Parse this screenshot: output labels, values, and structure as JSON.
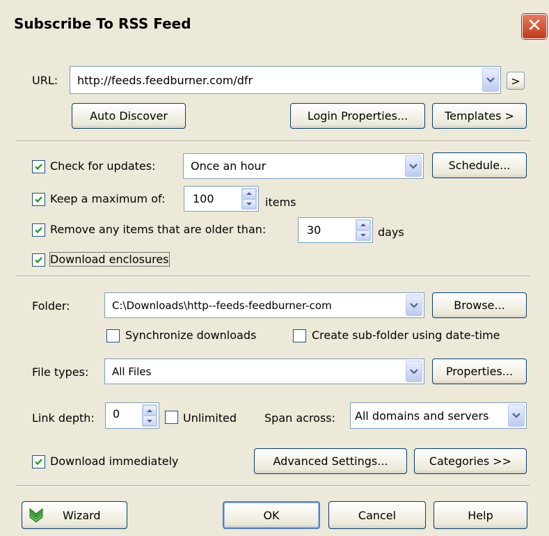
{
  "window": {
    "title": "Subscribe To RSS Feed",
    "close": "✕"
  },
  "url": {
    "label": "URL:",
    "value": "http://feeds.feedburner.com/dfr",
    "go": ">"
  },
  "buttons": {
    "auto_discover": "Auto Discover",
    "login_properties": "Login Properties...",
    "templates": "Templates >",
    "schedule": "Schedule...",
    "browse": "Browse...",
    "properties": "Properties...",
    "advanced_settings": "Advanced Settings...",
    "categories": "Categories >>",
    "wizard": "Wizard",
    "ok": "OK",
    "cancel": "Cancel",
    "help": "Help"
  },
  "updates": {
    "check_label": "Check for updates:",
    "check_checked": true,
    "frequency": "Once an hour",
    "max_label": "Keep a maximum of:",
    "max_checked": true,
    "max_value": "100",
    "max_unit": "items",
    "remove_label": "Remove any items that are older than:",
    "remove_checked": true,
    "remove_value": "30",
    "remove_unit": "days",
    "enclosures_label": "Download enclosures",
    "enclosures_checked": true
  },
  "download": {
    "folder_label": "Folder:",
    "folder_value": "C:\\Downloads\\http--feeds-feedburner-com",
    "sync_label": "Synchronize downloads",
    "sync_checked": false,
    "subfolder_label": "Create sub-folder using date-time",
    "subfolder_checked": false,
    "filetypes_label": "File types:",
    "filetypes_value": "All Files",
    "linkdepth_label": "Link depth:",
    "linkdepth_value": "0",
    "unlimited_label": "Unlimited",
    "unlimited_checked": false,
    "span_label": "Span across:",
    "span_value": "All domains and servers",
    "immediately_label": "Download immediately",
    "immediately_checked": true
  },
  "colors": {
    "face": "#ece9d8",
    "check": "#21a121",
    "button_border": "#003c74"
  },
  "icons": {
    "wizard": "green-double-chevron-icon"
  }
}
